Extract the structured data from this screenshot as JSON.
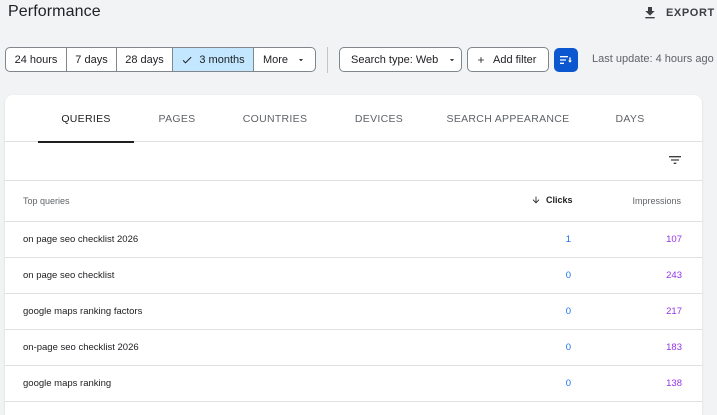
{
  "header": {
    "title": "Performance",
    "export_label": "EXPORT"
  },
  "filters": {
    "ranges": [
      {
        "label": "24 hours",
        "selected": false
      },
      {
        "label": "7 days",
        "selected": false
      },
      {
        "label": "28 days",
        "selected": false
      },
      {
        "label": "3 months",
        "selected": true
      },
      {
        "label": "More",
        "selected": false
      }
    ],
    "search_type": "Search type: Web",
    "add_filter": "Add filter",
    "last_update": "Last update: 4 hours ago"
  },
  "tabs": [
    "QUERIES",
    "PAGES",
    "COUNTRIES",
    "DEVICES",
    "SEARCH APPEARANCE",
    "DAYS"
  ],
  "table": {
    "headers": {
      "query": "Top queries",
      "clicks": "Clicks",
      "impressions": "Impressions"
    },
    "rows": [
      {
        "query": "on page seo checklist 2026",
        "clicks": "1",
        "impressions": "107"
      },
      {
        "query": "on page seo checklist",
        "clicks": "0",
        "impressions": "243"
      },
      {
        "query": "google maps ranking factors",
        "clicks": "0",
        "impressions": "217"
      },
      {
        "query": "on-page seo checklist 2026",
        "clicks": "0",
        "impressions": "183"
      },
      {
        "query": "google maps ranking",
        "clicks": "0",
        "impressions": "138"
      }
    ]
  },
  "colors": {
    "accent": "#0b57d0",
    "selected_chip": "#c2e7ff",
    "clicks": "#1a73e8",
    "impressions": "#9334e6"
  }
}
